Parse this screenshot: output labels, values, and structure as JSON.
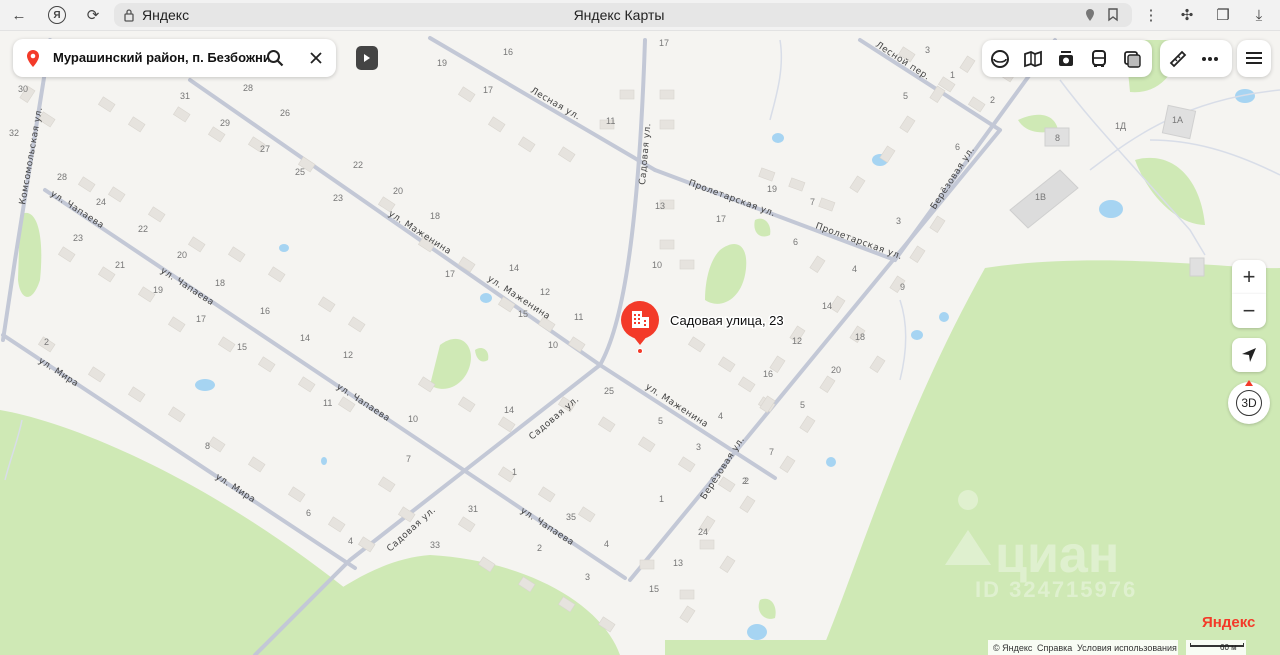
{
  "browser": {
    "site": "Яндекс",
    "title": "Яндекс Карты",
    "logo_letter": "Я"
  },
  "search": {
    "value": "Мурашинский район, п. Безбожник, у"
  },
  "marker": {
    "label": "Садовая улица, 23",
    "color": "#f33a29"
  },
  "controls": {
    "zoom_in": "+",
    "zoom_out": "−",
    "view_3d": "3D",
    "layer_icons": [
      "panorama-icon",
      "map-layers-icon",
      "photos-icon",
      "transit-icon",
      "traffic-icon"
    ],
    "extra_icons": [
      "ruler-icon",
      "more-icon"
    ]
  },
  "streets": [
    "ул. Маженина",
    "ул. Маженина",
    "ул. Маженина",
    "Садовая ул.",
    "Садовая ул.",
    "Садовая ул.",
    "Пролетарская ул.",
    "Пролетарская ул.",
    "Лесная ул.",
    "Лесной пер.",
    "Берёзовая ул.",
    "Берёзовая ул.",
    "ул. Чапаева",
    "ул. Чапаева",
    "ул. Чапаева",
    "ул. Чапаева",
    "ул. Мира",
    "ул. Мира",
    "Комсомольская ул."
  ],
  "house_numbers": [
    "30",
    "31",
    "28",
    "32",
    "29",
    "26",
    "27",
    "25",
    "28",
    "24",
    "22",
    "20",
    "23",
    "21",
    "19",
    "18",
    "17",
    "16",
    "15",
    "14",
    "12",
    "11",
    "10",
    "8",
    "7",
    "6",
    "4",
    "2",
    "16",
    "19",
    "17",
    "22",
    "20",
    "23",
    "18",
    "17",
    "14",
    "15",
    "12",
    "11",
    "10",
    "14",
    "25",
    "5",
    "4",
    "3",
    "2",
    "1",
    "31",
    "33",
    "35",
    "4",
    "2",
    "3",
    "1",
    "24",
    "13",
    "15",
    "17",
    "11",
    "13",
    "10",
    "17",
    "19",
    "7",
    "6",
    "4",
    "3",
    "14",
    "12",
    "16",
    "18",
    "20",
    "5",
    "7",
    "9",
    "2",
    "3",
    "1",
    "4",
    "2",
    "5",
    "6",
    "8",
    "1Д",
    "1А",
    "1В",
    "1Г"
  ],
  "watermark": {
    "brand": "циан",
    "id_text": "ID 324715976"
  },
  "footer": {
    "brand": "Яндекс",
    "copyright": "© Яндекс",
    "help": "Справка",
    "terms": "Условия использования",
    "scale": "60 м"
  }
}
